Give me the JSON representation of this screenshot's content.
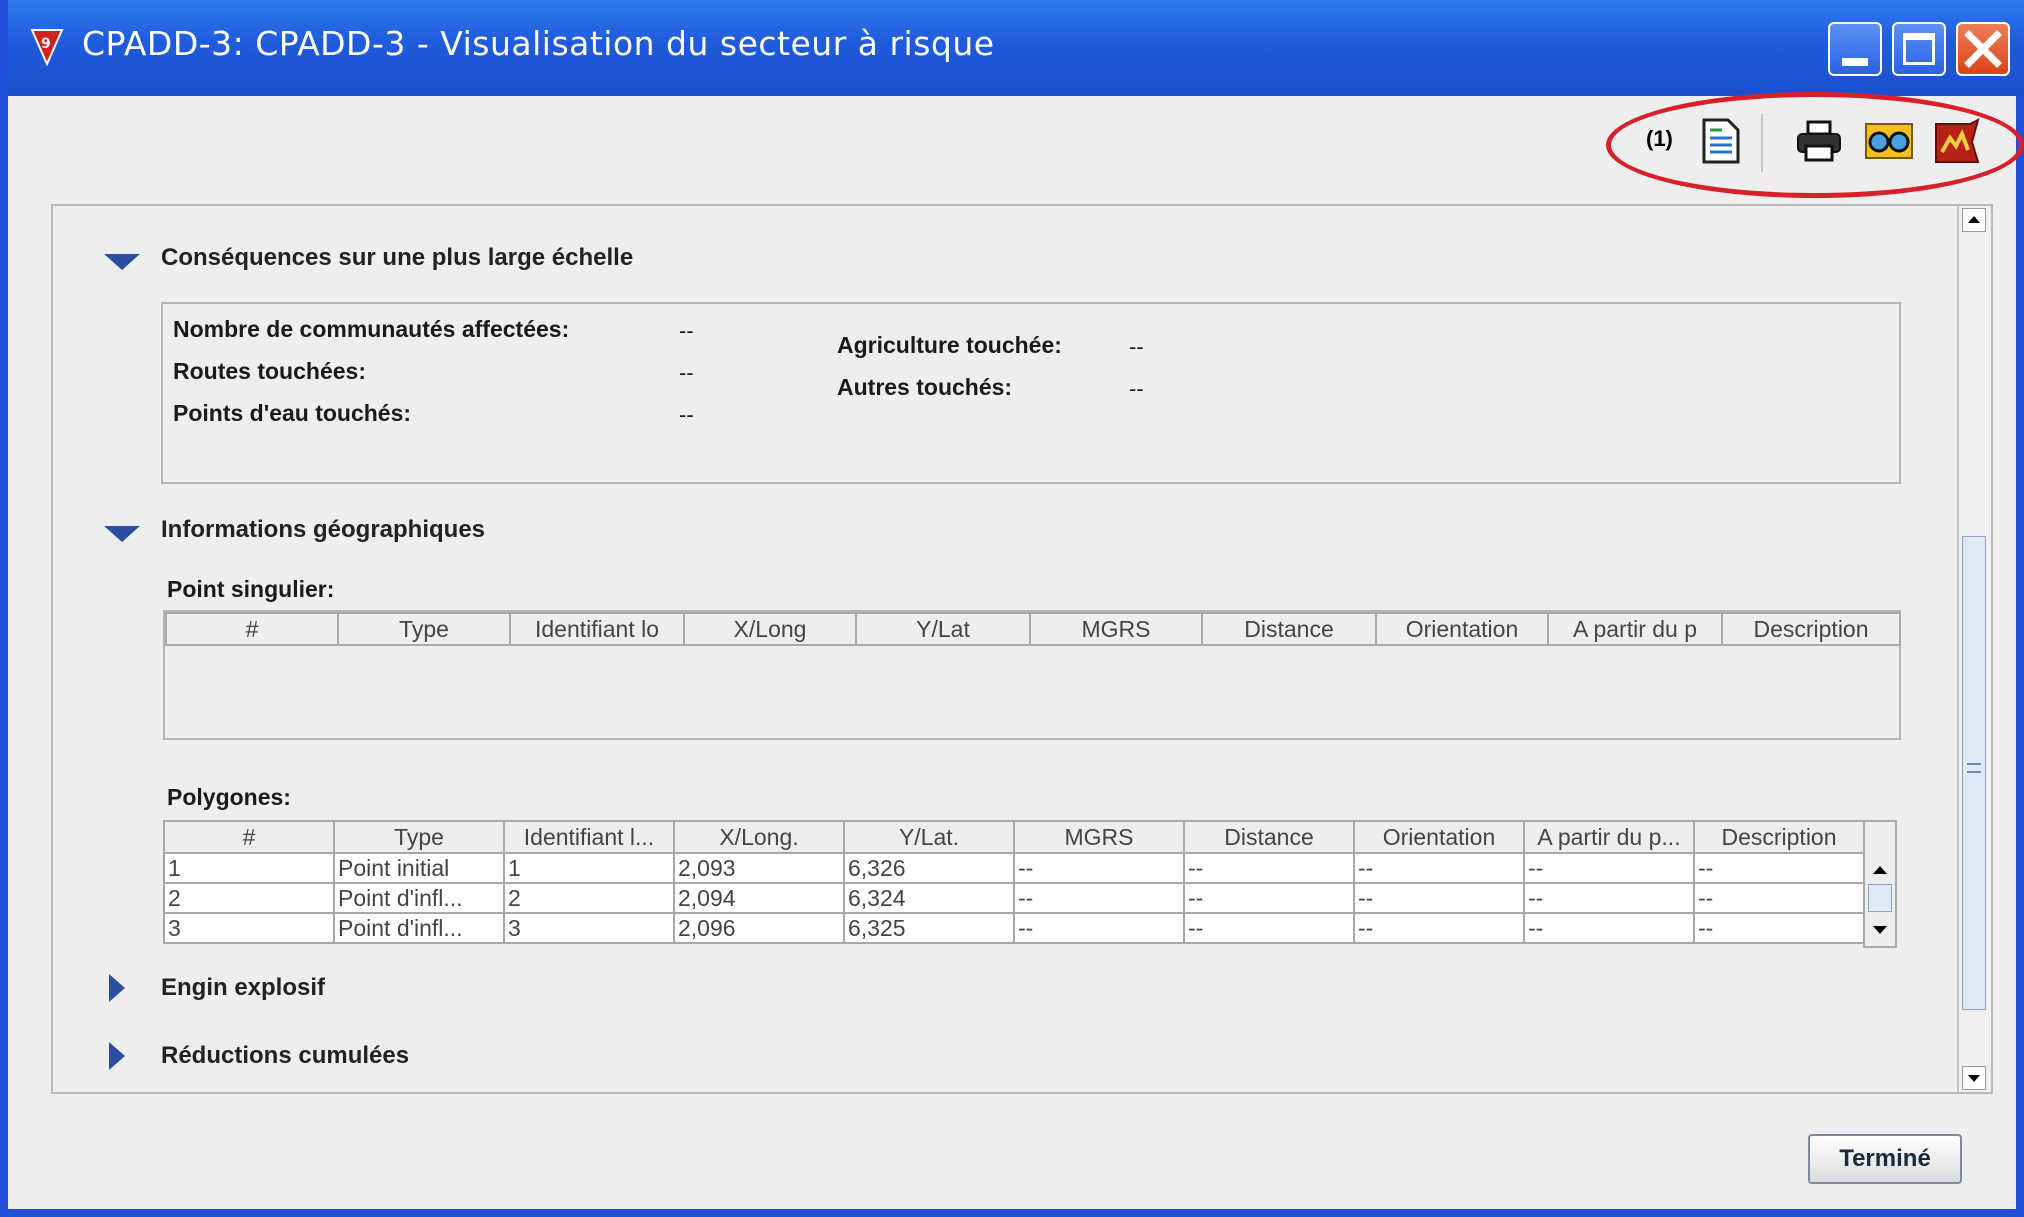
{
  "window": {
    "title": "CPADD-3: CPADD-3 - Visualisation du secteur à risque",
    "controls": [
      "minimize-icon",
      "maximize-icon",
      "close-icon"
    ]
  },
  "toolbar": {
    "count_label": "(1)",
    "icons": [
      "document-icon",
      "print-icon",
      "glasses-icon",
      "map-icon"
    ]
  },
  "sections": {
    "consequences": {
      "title": "Conséquences sur une plus large échelle",
      "expanded": true,
      "fields_left": [
        {
          "label": "Nombre de communautés affectées:",
          "value": "--"
        },
        {
          "label": "Routes touchées:",
          "value": "--"
        },
        {
          "label": "Points d'eau touchés:",
          "value": "--"
        }
      ],
      "fields_right": [
        {
          "label": "Agriculture touchée:",
          "value": "--"
        },
        {
          "label": "Autres touchés:",
          "value": "--"
        }
      ]
    },
    "geo": {
      "title": "Informations géographiques",
      "expanded": true,
      "point_singulier": {
        "label": "Point singulier:",
        "columns": [
          "#",
          "Type",
          "Identifiant lo",
          "X/Long",
          "Y/Lat",
          "MGRS",
          "Distance",
          "Orientation",
          "A partir du p",
          "Description"
        ],
        "rows": []
      },
      "polygones": {
        "label": "Polygones:",
        "columns": [
          "#",
          "Type",
          "Identifiant l...",
          "X/Long.",
          "Y/Lat.",
          "MGRS",
          "Distance",
          "Orientation",
          "A partir du p...",
          "Description"
        ],
        "rows": [
          [
            "1",
            "Point initial",
            "1",
            "2,093",
            "6,326",
            "--",
            "--",
            "--",
            "--",
            "--"
          ],
          [
            "2",
            "Point d'infl...",
            "2",
            "2,094",
            "6,324",
            "--",
            "--",
            "--",
            "--",
            "--"
          ],
          [
            "3",
            "Point d'infl...",
            "3",
            "2,096",
            "6,325",
            "--",
            "--",
            "--",
            "--",
            "--"
          ]
        ]
      }
    },
    "engin": {
      "title": "Engin explosif",
      "expanded": false
    },
    "reductions": {
      "title": "Réductions cumulées",
      "expanded": false
    }
  },
  "footer": {
    "done_label": "Terminé"
  },
  "colors": {
    "titlebar": "#1f5bdc",
    "highlight": "#d9202a",
    "section_arrow": "#2a4fa0"
  }
}
